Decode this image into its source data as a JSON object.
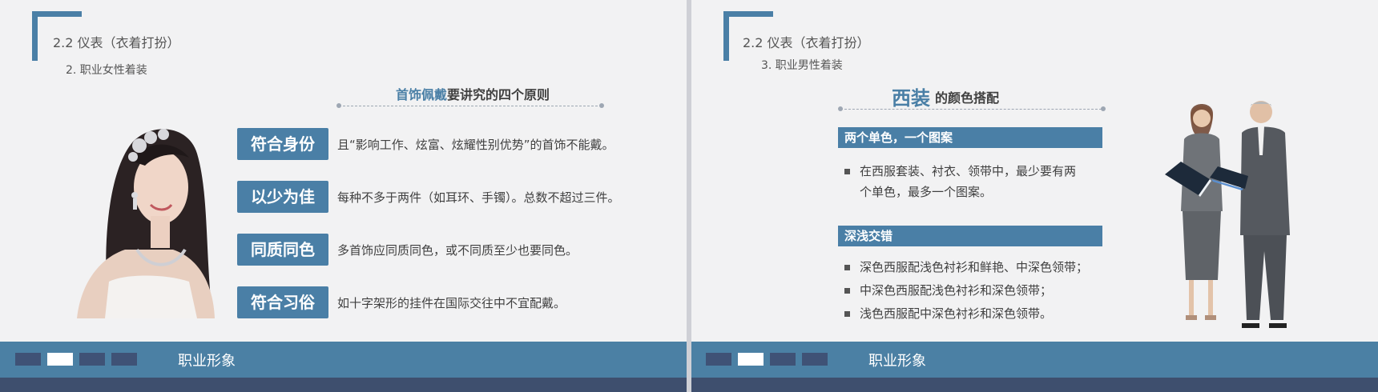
{
  "left_slide": {
    "section_title": "2.2  仪表（衣着打扮）",
    "section_subtitle": "2. 职业女性着装",
    "heading_accent": "首饰佩戴",
    "heading_rest": "要讲究的四个原则",
    "rules": [
      {
        "label": "符合身份",
        "text": "且“影响工作、炫富、炫耀性别优势”的首饰不能戴。"
      },
      {
        "label": "以少为佳",
        "text": "每种不多于两件（如耳环、手镯）。总数不超过三件。"
      },
      {
        "label": "同质同色",
        "text": "多首饰应同质同色，或不同质至少也要同色。"
      },
      {
        "label": "符合习俗",
        "text": "如十字架形的挂件在国际交往中不宜配戴。"
      }
    ],
    "footer_text": "职业形象"
  },
  "right_slide": {
    "section_title": "2.2  仪表（衣着打扮）",
    "section_subtitle": "3. 职业男性着装",
    "heading_big": "西装",
    "heading_small": "的颜色搭配",
    "block1": {
      "title": "两个单色，一个图案",
      "lines": [
        "在西服套装、衬衣、领带中，最少要有两",
        "个单色，最多一个图案。"
      ]
    },
    "block2": {
      "title": "深浅交错",
      "items": [
        "深色西服配浅色衬衫和鲜艳、中深色领带；",
        "中深色西服配浅色衬衫和深色领带；",
        "浅色西服配中深色衬衫和深色领带。"
      ]
    },
    "footer_text": "职业形象"
  },
  "colors": {
    "accent": "#4a7fa6",
    "footer_dark": "#3e4f6e",
    "slide_bg": "#f2f2f3"
  }
}
